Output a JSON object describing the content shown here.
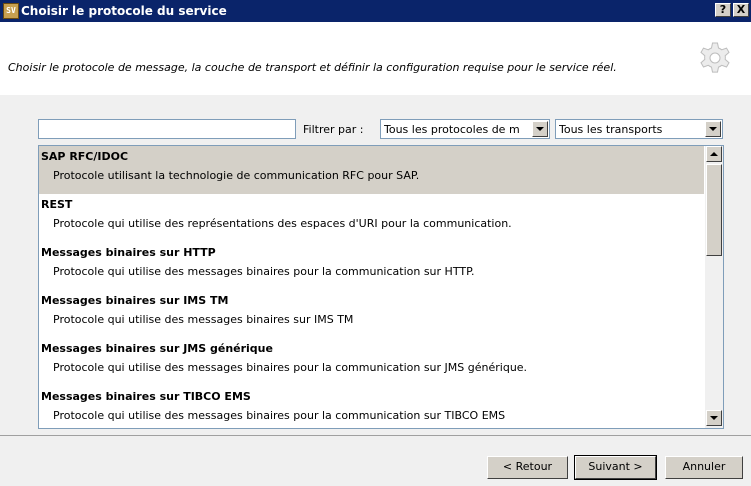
{
  "window": {
    "icon_text": "SV",
    "title": "Choisir le protocole du service",
    "help_button": "?",
    "close_button": "X"
  },
  "header": {
    "description": "Choisir le protocole de message, la couche de transport et définir la configuration requise pour le service réel."
  },
  "filter": {
    "search_value": "",
    "label": "Filtrer par :",
    "protocol_select": "Tous les protocoles de m",
    "transport_select": "Tous les transports"
  },
  "protocols": [
    {
      "name": "SAP RFC/IDOC",
      "description": "Protocole utilisant la technologie de communication RFC pour SAP.",
      "selected": true
    },
    {
      "name": "REST",
      "description": "Protocole qui utilise des représentations des espaces d'URI pour la communication.",
      "selected": false
    },
    {
      "name": "Messages binaires sur HTTP",
      "description": "Protocole qui utilise des messages binaires pour la communication sur HTTP.",
      "selected": false
    },
    {
      "name": "Messages binaires sur IMS TM",
      "description": "Protocole qui utilise des messages binaires sur IMS TM",
      "selected": false
    },
    {
      "name": "Messages binaires sur JMS générique",
      "description": "Protocole qui utilise des messages binaires pour la communication sur JMS générique.",
      "selected": false
    },
    {
      "name": "Messages binaires sur TIBCO EMS",
      "description": "Protocole qui utilise des messages binaires pour la communication sur TIBCO EMS",
      "selected": false
    }
  ],
  "footer": {
    "back_label": "< Retour",
    "next_label": "Suivant >",
    "cancel_label": "Annuler"
  }
}
